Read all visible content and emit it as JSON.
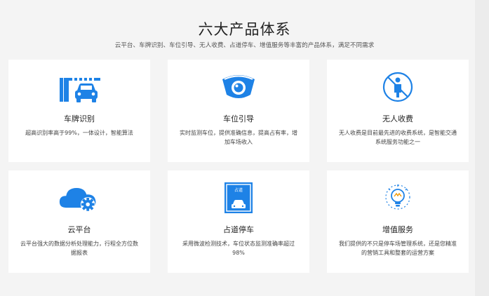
{
  "section": {
    "title": "六大产品体系",
    "subtitle": "云平台、车牌识别、车位引导、无人收费、占道停车、增值服务等丰富的产品体系，满足不同需求"
  },
  "colors": {
    "accent": "#1e82e6",
    "background": "#f4f4f4",
    "card": "#ffffff"
  },
  "products": [
    {
      "icon": "parking-gate-car-icon",
      "name": "车牌识别",
      "desc": "超高识别率高于99%，一体设计，智能算法"
    },
    {
      "icon": "camera-icon",
      "name": "车位引导",
      "desc": "实时监测车位，提供准确信息，提高占有率，增加车场收入"
    },
    {
      "icon": "no-person-icon",
      "name": "无人收费",
      "desc": "无人收费是目前最先进的收费系统，是智能交通系统服务功能之一"
    },
    {
      "icon": "cloud-gear-icon",
      "name": "云平台",
      "desc": "云平台强大的数据分析处理能力，行程全方位数据报表"
    },
    {
      "icon": "roadside-parking-sign-icon",
      "name": "占道停车",
      "desc": "采用微波检测技术，车位状态监测准确率超过98%"
    },
    {
      "icon": "lightbulb-icon",
      "name": "增值服务",
      "desc": "我们提供的不只是停车场管理系统，还是您精准的营销工具和整套的运营方案"
    }
  ],
  "sign_text": "占道"
}
